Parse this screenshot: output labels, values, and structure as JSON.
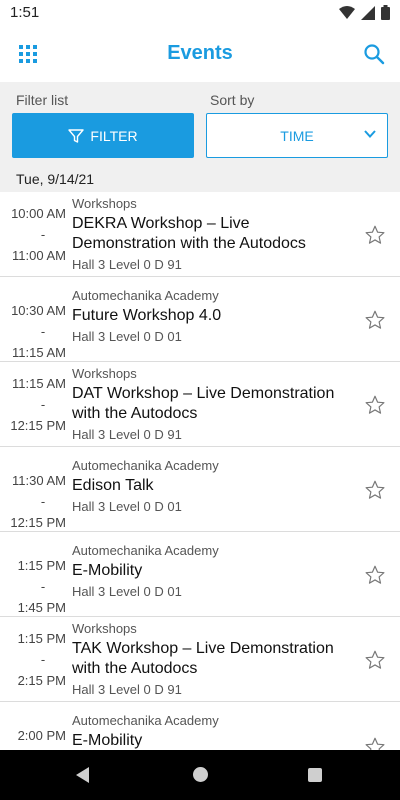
{
  "status": {
    "time": "1:51"
  },
  "header": {
    "title": "Events",
    "menu_icon": "grid-icon",
    "search_icon": "search-icon",
    "accent": "#1a9be0"
  },
  "filters": {
    "filter_label": "Filter list",
    "sort_label": "Sort by",
    "filter_button": "FILTER",
    "sort_value": "TIME"
  },
  "date_header": "Tue, 9/14/21",
  "events": [
    {
      "start": "10:00 AM",
      "dash": "-",
      "end": "11:00 AM",
      "category": "Workshops",
      "title": "DEKRA Workshop – Live Demonstration with the Autodocs",
      "location": "Hall 3 Level 0 D 91"
    },
    {
      "start": "10:30 AM",
      "dash": "-",
      "end": "11:15 AM",
      "category": "Automechanika Academy",
      "title": "Future Workshop 4.0",
      "location": "Hall 3 Level 0 D 01"
    },
    {
      "start": "11:15 AM",
      "dash": "-",
      "end": "12:15 PM",
      "category": "Workshops",
      "title": "DAT Workshop – Live Demonstration with the Autodocs",
      "location": "Hall 3 Level 0 D 91"
    },
    {
      "start": "11:30 AM",
      "dash": "-",
      "end": "12:15 PM",
      "category": "Automechanika Academy",
      "title": "Edison Talk",
      "location": "Hall 3 Level 0 D 01"
    },
    {
      "start": "1:15 PM",
      "dash": "-",
      "end": "1:45 PM",
      "category": "Automechanika Academy",
      "title": "E-Mobility",
      "location": "Hall 3 Level 0 D 01"
    },
    {
      "start": "1:15 PM",
      "dash": "-",
      "end": "2:15 PM",
      "category": "Workshops",
      "title": "TAK Workshop – Live Demonstration with the Autodocs",
      "location": "Hall 3 Level 0 D 91"
    },
    {
      "start": "2:00 PM",
      "dash": "-",
      "end": "",
      "category": "Automechanika Academy",
      "title": "E-Mobility",
      "location": ""
    }
  ]
}
